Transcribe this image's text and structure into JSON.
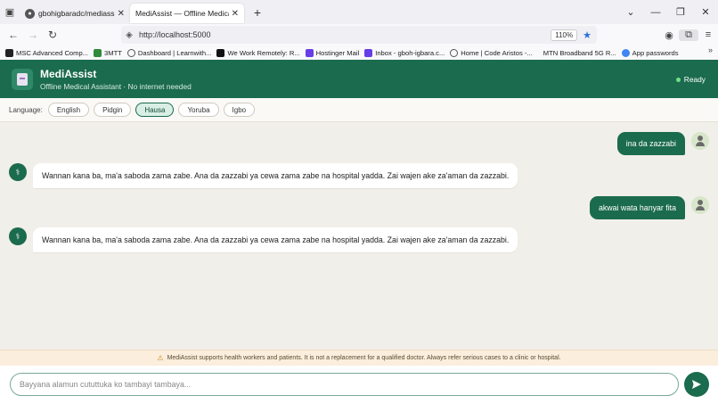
{
  "browser": {
    "tabs": [
      {
        "title": "gbohigbaradc/mediassist_subm",
        "active": false
      },
      {
        "title": "MediAssist — Offline Medical Assist",
        "active": true
      }
    ],
    "url": "http://localhost:5000",
    "zoom": "110%",
    "bookmarks": [
      "MSC Advanced Comp...",
      "3MTT",
      "Dashboard | Learnwith...",
      "We Work Remotely: R...",
      "Hostinger Mail",
      "Inbox - gboh-igbara.c...",
      "Home | Code Aristos -...",
      "MTN Broadband 5G R...",
      "App passwords"
    ]
  },
  "header": {
    "title": "MediAssist",
    "subtitle": "Offline Medical Assistant · No internet needed",
    "status": "Ready"
  },
  "language": {
    "label": "Language:",
    "options": [
      "English",
      "Pidgin",
      "Hausa",
      "Yoruba",
      "Igbo"
    ],
    "selected": "Hausa"
  },
  "messages": [
    {
      "role": "user",
      "text": "ina da zazzabi"
    },
    {
      "role": "bot",
      "text": "Wannan kana ba, ma'a saboda zama zabe. Ana da zazzabi ya cewa zama zabe na hospital yadda. Zai wajen ake za'aman da zazzabi."
    },
    {
      "role": "user",
      "text": "akwai wata hanyar fita"
    },
    {
      "role": "bot",
      "text": "Wannan kana ba, ma'a saboda zama zabe. Ana da zazzabi ya cewa zama zabe na hospital yadda. Zai wajen ake za'aman da zazzabi."
    }
  ],
  "disclaimer": "MediAssist supports health workers and patients. It is not a replacement for a qualified doctor. Always refer serious cases to a clinic or hospital.",
  "composer": {
    "placeholder": "Bayyana alamun cututtuka ko tambayi tambaya..."
  },
  "colors": {
    "brand": "#1b6b4e",
    "active_language_bg": "#d9efe6",
    "status_dot": "#6fe08a",
    "disclaimer_bg": "#fbeedd"
  }
}
